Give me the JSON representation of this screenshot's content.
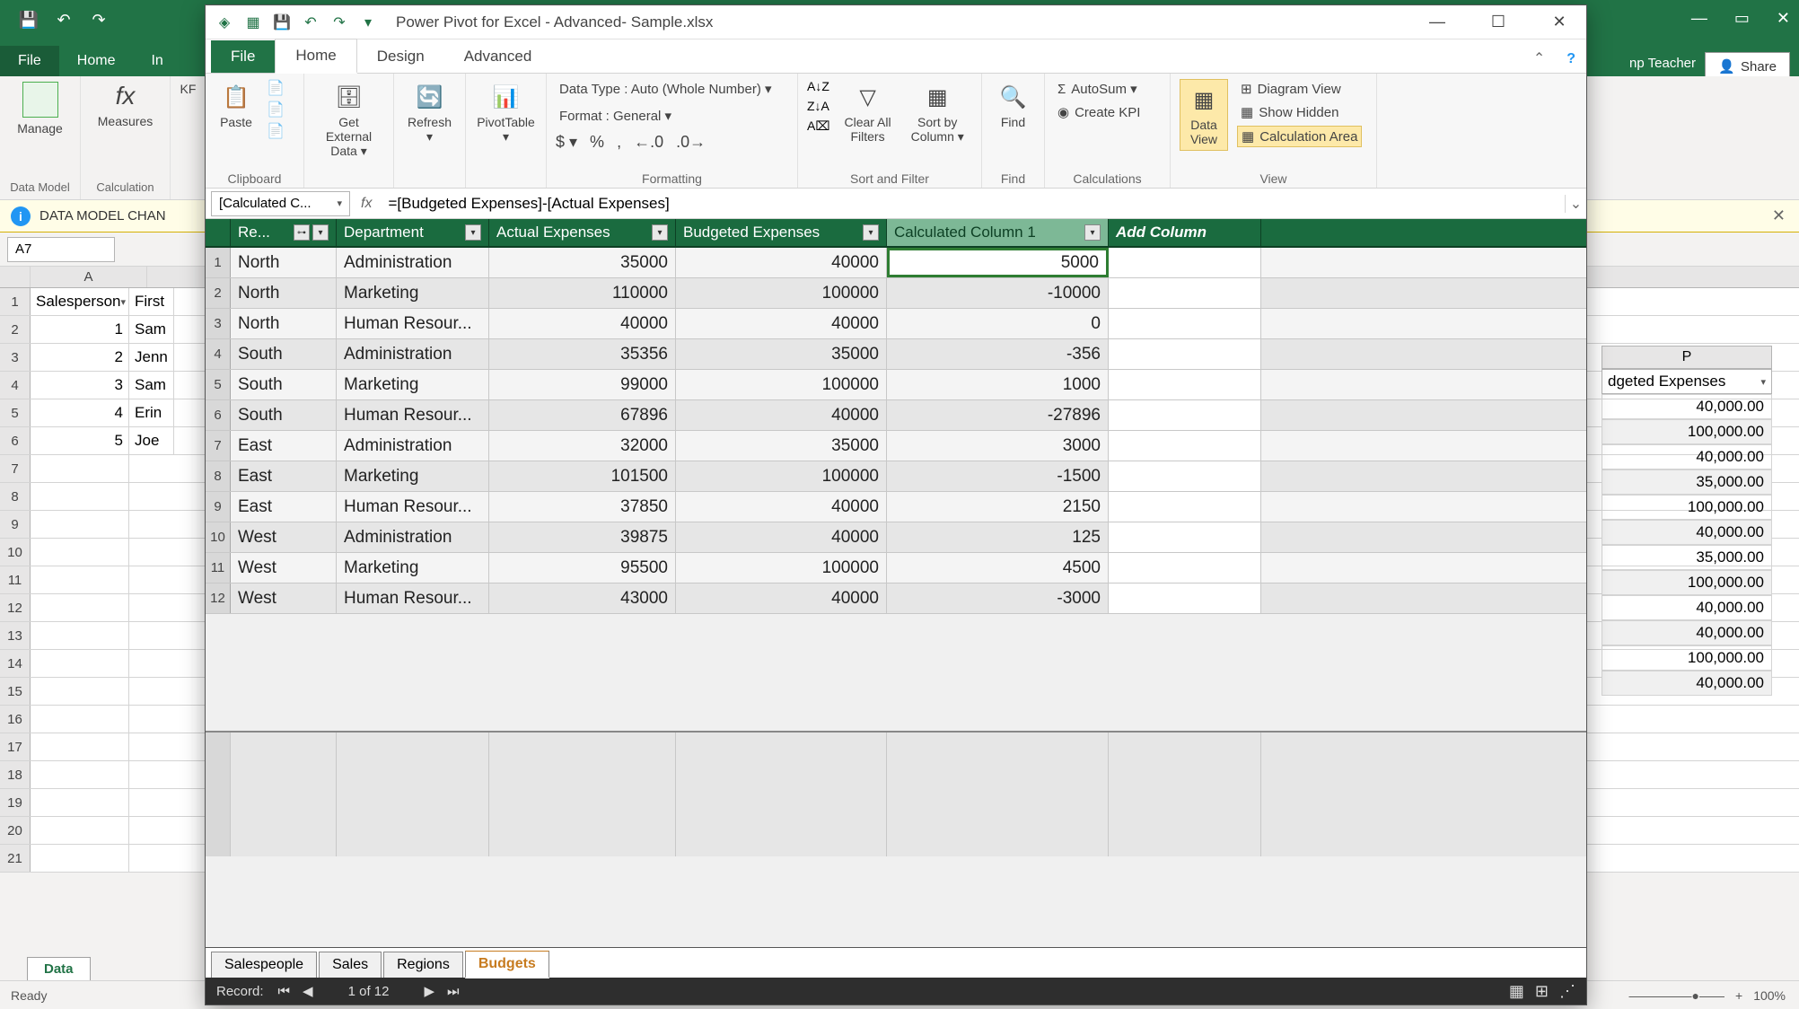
{
  "excel": {
    "tabs": {
      "file": "File",
      "home": "Home",
      "in": "In"
    },
    "share": "Share",
    "teacher": "np Teacher",
    "ribbon": {
      "manage": "Manage",
      "data_model": "Data Model",
      "measures": "Measures",
      "kf": "KF",
      "calculation": "Calculation"
    },
    "msg_bar": "DATA MODEL CHAN",
    "namebox": "A7",
    "col_a": "A",
    "col_p": "P",
    "headers": {
      "salesperson": "Salesperson",
      "first": "First"
    },
    "rows": [
      {
        "n": "1",
        "a": "1",
        "b": "Sam"
      },
      {
        "n": "2",
        "a": "2",
        "b": "Jenn"
      },
      {
        "n": "3",
        "a": "3",
        "b": "Sam"
      },
      {
        "n": "4",
        "a": "4",
        "b": "Erin"
      },
      {
        "n": "5",
        "a": "5",
        "b": "Joe"
      }
    ],
    "sheet_tab": "Data",
    "status": "Ready",
    "zoom": "100%",
    "p_header": "dgeted Expenses",
    "p_values": [
      "40,000.00",
      "100,000.00",
      "40,000.00",
      "35,000.00",
      "100,000.00",
      "40,000.00",
      "35,000.00",
      "100,000.00",
      "40,000.00",
      "40,000.00",
      "100,000.00",
      "40,000.00"
    ]
  },
  "pp": {
    "title": "Power Pivot for Excel - Advanced- Sample.xlsx",
    "tabs": {
      "file": "File",
      "home": "Home",
      "design": "Design",
      "advanced": "Advanced"
    },
    "ribbon": {
      "paste": "Paste",
      "get_data": "Get External\nData ▾",
      "refresh": "Refresh\n▾",
      "pivot": "PivotTable\n▾",
      "data_type": "Data Type : Auto (Whole Number) ▾",
      "format": "Format : General ▾",
      "clear_filters": "Clear All\nFilters",
      "sort_col": "Sort by\nColumn ▾",
      "find": "Find",
      "autosum": "AutoSum ▾",
      "create_kpi": "Create KPI",
      "data_view": "Data\nView",
      "diagram_view": "Diagram View",
      "show_hidden": "Show Hidden",
      "calc_area": "Calculation Area",
      "groups": {
        "clipboard": "Clipboard",
        "formatting": "Formatting",
        "sort_filter": "Sort and Filter",
        "find_g": "Find",
        "calc": "Calculations",
        "view": "View"
      }
    },
    "namebox": "[Calculated C...",
    "formula": "=[Budgeted Expenses]-[Actual Expenses]",
    "columns": {
      "re": "Re...",
      "department": "Department",
      "actual": "Actual Expenses",
      "budgeted": "Budgeted Expenses",
      "calc": "Calculated Column 1",
      "add": "Add Column"
    },
    "rows": [
      {
        "n": "1",
        "re": "North",
        "dept": "Administration",
        "actual": "35000",
        "budget": "40000",
        "calc": "5000"
      },
      {
        "n": "2",
        "re": "North",
        "dept": "Marketing",
        "actual": "110000",
        "budget": "100000",
        "calc": "-10000"
      },
      {
        "n": "3",
        "re": "North",
        "dept": "Human Resour...",
        "actual": "40000",
        "budget": "40000",
        "calc": "0"
      },
      {
        "n": "4",
        "re": "South",
        "dept": "Administration",
        "actual": "35356",
        "budget": "35000",
        "calc": "-356"
      },
      {
        "n": "5",
        "re": "South",
        "dept": "Marketing",
        "actual": "99000",
        "budget": "100000",
        "calc": "1000"
      },
      {
        "n": "6",
        "re": "South",
        "dept": "Human Resour...",
        "actual": "67896",
        "budget": "40000",
        "calc": "-27896"
      },
      {
        "n": "7",
        "re": "East",
        "dept": "Administration",
        "actual": "32000",
        "budget": "35000",
        "calc": "3000"
      },
      {
        "n": "8",
        "re": "East",
        "dept": "Marketing",
        "actual": "101500",
        "budget": "100000",
        "calc": "-1500"
      },
      {
        "n": "9",
        "re": "East",
        "dept": "Human Resour...",
        "actual": "37850",
        "budget": "40000",
        "calc": "2150"
      },
      {
        "n": "10",
        "re": "West",
        "dept": "Administration",
        "actual": "39875",
        "budget": "40000",
        "calc": "125"
      },
      {
        "n": "11",
        "re": "West",
        "dept": "Marketing",
        "actual": "95500",
        "budget": "100000",
        "calc": "4500"
      },
      {
        "n": "12",
        "re": "West",
        "dept": "Human Resour...",
        "actual": "43000",
        "budget": "40000",
        "calc": "-3000"
      }
    ],
    "sheets": [
      "Salespeople",
      "Sales",
      "Regions",
      "Budgets"
    ],
    "status": {
      "record": "Record:",
      "pos": "1 of 12"
    }
  }
}
